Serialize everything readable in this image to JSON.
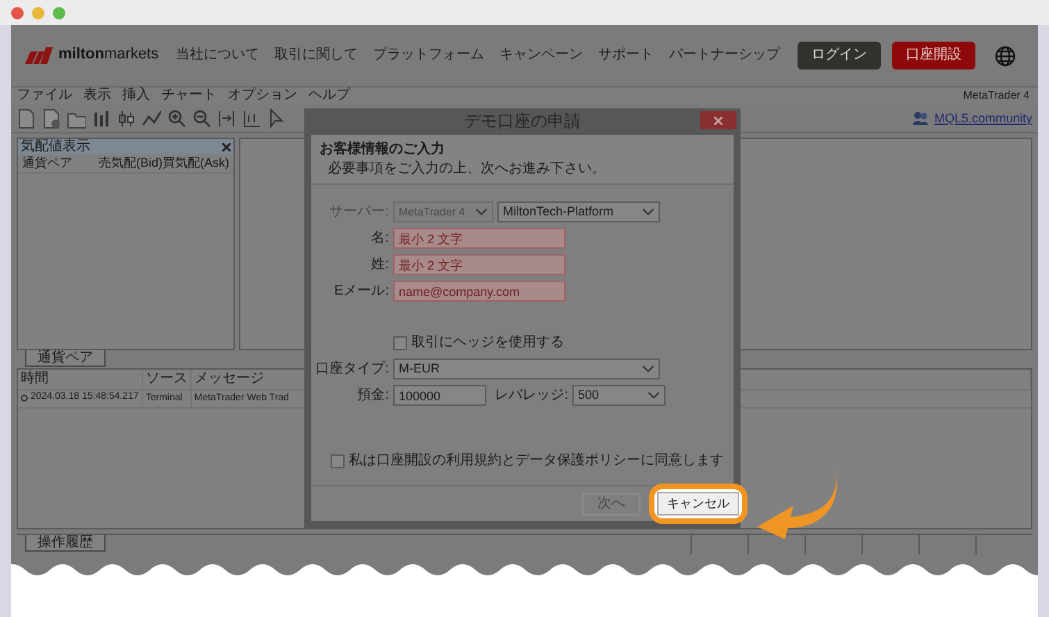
{
  "site_header": {
    "brand": "**milton**markets",
    "nav": [
      "当社について",
      "取引に関して",
      "プラットフォーム",
      "キャンペーン",
      "サポート",
      "パートナーシップ"
    ],
    "login_button": "ログイン",
    "signup_button": "口座開設"
  },
  "menu_bar": {
    "items": [
      "ファイル",
      "表示",
      "挿入",
      "チャート",
      "オプション",
      "ヘルプ"
    ],
    "app_name": "MetaTrader 4"
  },
  "toolbar": {
    "community_link": "MQL5.community"
  },
  "market_watch": {
    "title": "気配値表示",
    "columns": [
      "通貨ペア",
      "売気配(Bid)",
      "買気配(Ask)"
    ],
    "tab": "通貨ペア"
  },
  "journal": {
    "columns": [
      "時間",
      "ソース",
      "メッセージ"
    ],
    "rows": [
      {
        "time": "2024.03.18 15:48:54.217",
        "source": "Terminal",
        "message": "MetaTrader Web Trad"
      }
    ],
    "tab": "操作履歴"
  },
  "dialog": {
    "title": "デモ口座の申請",
    "heading": "お客様情報のご入力",
    "subheading": "必要事項をご入力の上、次へお進み下さい。",
    "server": {
      "label": "サーバー:",
      "platform": "MetaTrader 4",
      "platform_disabled": true,
      "value": "MiltonTech-Platform"
    },
    "first_name": {
      "label": "名:",
      "placeholder": "最小 2 文字",
      "invalid": true
    },
    "last_name": {
      "label": "姓:",
      "placeholder": "最小 2 文字",
      "invalid": true
    },
    "email": {
      "label": "Eメール:",
      "placeholder": "name@company.com",
      "invalid": true
    },
    "hedge": {
      "label": "取引にヘッジを使用する",
      "checked": false
    },
    "account_type": {
      "label": "口座タイプ:",
      "value": "M-EUR"
    },
    "deposit": {
      "label": "預金:",
      "value": "100000"
    },
    "leverage": {
      "label": "レバレッジ:",
      "value": "500"
    },
    "agreement": {
      "label": "私は口座開設の利用規約とデータ保護ポリシーに同意します",
      "checked": false
    },
    "buttons": [
      {
        "label": "次へ",
        "disabled": true,
        "highlighted": false
      },
      {
        "label": "キャンセル",
        "disabled": false,
        "highlighted": true
      }
    ]
  }
}
